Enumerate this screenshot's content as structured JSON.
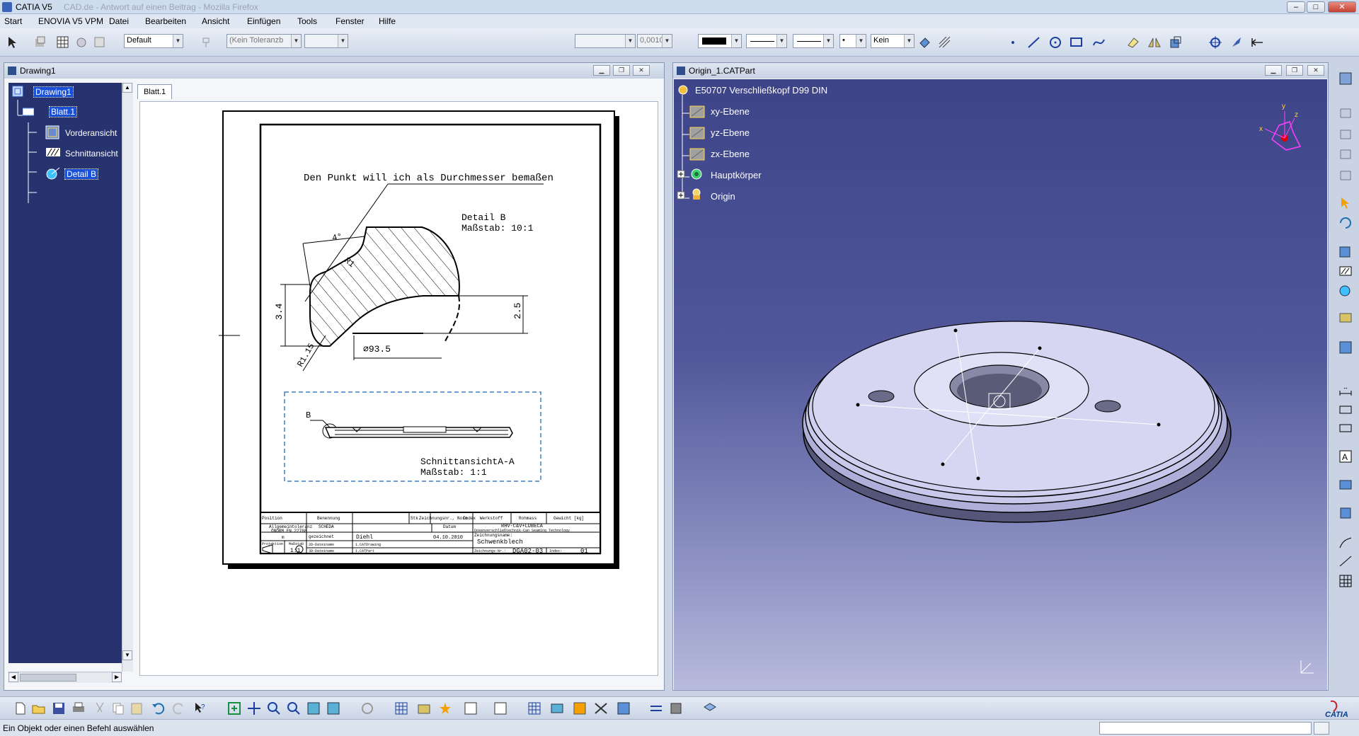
{
  "window": {
    "title": "CATIA V5",
    "ghost_title": "CAD.de - Antwort auf einen Beitrag - Mozilla Firefox"
  },
  "menu": [
    "Start",
    "ENOVIA V5 VPM",
    "Datei",
    "Bearbeiten",
    "Ansicht",
    "Einfügen",
    "Tools",
    "Fenster",
    "Hilfe"
  ],
  "toolbar": {
    "style_combo": "Default",
    "tolerance_combo": "(Kein Toleranzb",
    "tolerance_combo2": "",
    "value_combo": "",
    "precision_combo": "0,0010",
    "color_combo": "",
    "line_combo1": "",
    "line_combo2": "",
    "point_combo": "•",
    "fill_combo": "Kein"
  },
  "drawing_window": {
    "title": "Drawing1",
    "tree": [
      {
        "label": "Drawing1"
      },
      {
        "label": "Blatt.1"
      },
      {
        "label": "Vorderansicht"
      },
      {
        "label": "Schnittansicht"
      },
      {
        "label": "Detail B"
      }
    ],
    "sheet_tab": "Blatt.1"
  },
  "drawing": {
    "annotation": "Den Punkt will ich als Durchmesser bemaßen",
    "detail_title": "Detail B",
    "detail_scale": "Maßstab:  10:1",
    "dim_angle": "4°",
    "dim_r1": "R1",
    "dim_34": "3.4",
    "dim_25": "2.5",
    "dim_r115": "R1.15",
    "dim_dia": "⌀93.5",
    "section_label": "B",
    "section_title": "SchnittansichtA-A",
    "section_scale": "Maßstab:  1:1",
    "titleblock": {
      "position": "Position",
      "benennung": "Benennung",
      "stk": "Stk.",
      "zeichnungsnr": "Zeichnungsnr., Norm",
      "index_h": "Index",
      "werkstoff": "Werkstoff",
      "rohmass": "Rohmass",
      "gewicht": "Gewicht [kg]",
      "allg_tol1": "Allgemeintoleranz",
      "allg_tol2": "ÖNORM EN 22768",
      "allg_tol3": "m",
      "scheda": "SCHEDA",
      "datum": "Datum",
      "company1": "RHV-C&V+LUBECA",
      "company2": "Dosenverschließtechnik-Can Seaming Technology",
      "gezeichnet": "gezeichnet",
      "name": "Diehl",
      "date": "04.10.2010",
      "zeichnungsname_label": "Zeichnungsname:",
      "zeichnungsname": "Schwenkblech",
      "projektion": "Projektion",
      "massstab_label": "Maßstab",
      "massstab": "1:1",
      "dateiname2d_label": "2D-Dateiname",
      "dateiname2d": "1.CATDrawing",
      "dateiname3d_label": "3D-Dateiname",
      "dateiname3d": "1.CATPart",
      "zeichnungsnr_label": "Zeichnungs-Nr.:",
      "zeichnungsnr_value": "DGA02-03",
      "index_label": "Index:",
      "index_value": "01"
    }
  },
  "part_window": {
    "title": "Origin_1.CATPart",
    "tree": [
      {
        "label": "E50707 Verschließkopf D99 DIN"
      },
      {
        "label": "xy-Ebene"
      },
      {
        "label": "yz-Ebene"
      },
      {
        "label": "zx-Ebene"
      },
      {
        "label": "Hauptkörper"
      },
      {
        "label": "Origin"
      }
    ],
    "compass_x": "x",
    "compass_y": "y",
    "compass_z": "z"
  },
  "status": {
    "message": "Ein Objekt oder einen Befehl auswählen"
  },
  "brand": {
    "logo_text": "CATIA"
  },
  "colors": {
    "tree_bg": "#27336e",
    "viewer_top": "#3d4488",
    "viewer_bottom": "#b8bbdc",
    "selection": "#1a4fd8",
    "part_face": "#c8c8ea"
  }
}
